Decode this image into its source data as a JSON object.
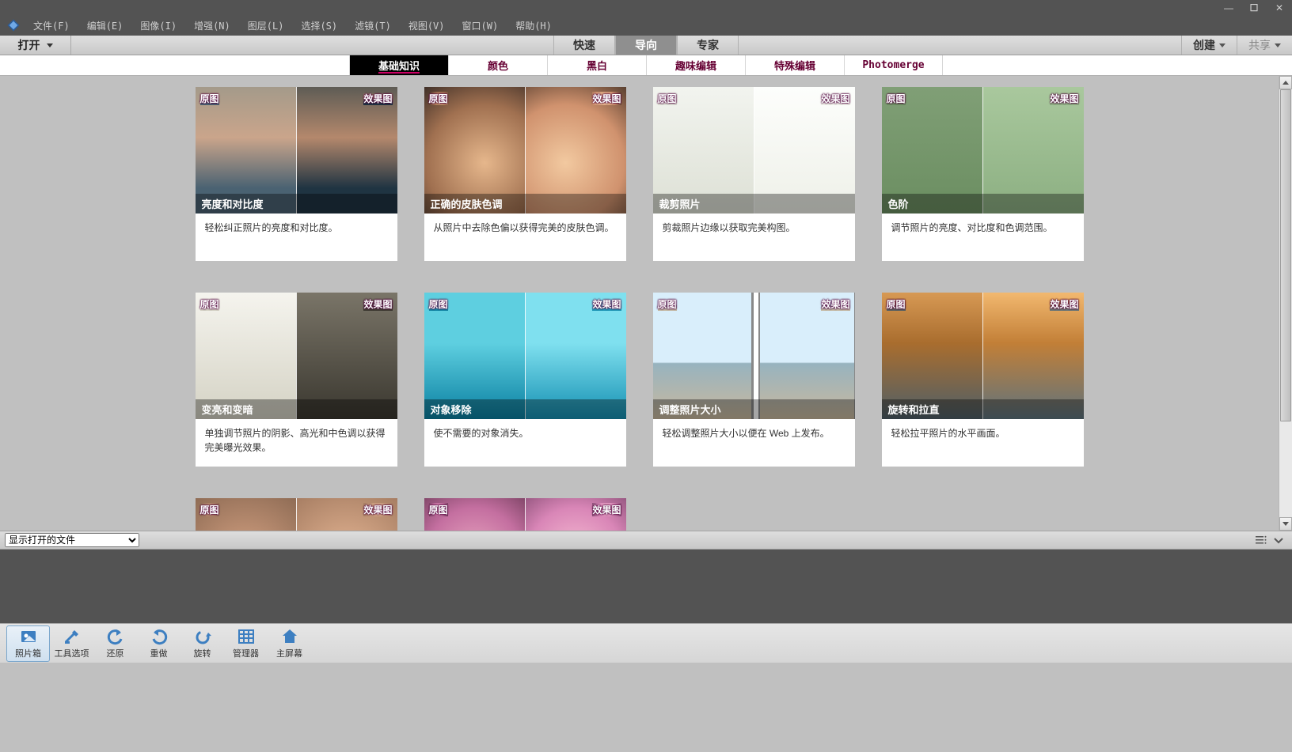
{
  "window_controls": {
    "min": "—",
    "max": "☐",
    "close": "✕"
  },
  "menu": [
    "文件(F)",
    "编辑(E)",
    "图像(I)",
    "增强(N)",
    "图层(L)",
    "选择(S)",
    "滤镜(T)",
    "视图(V)",
    "窗口(W)",
    "帮助(H)"
  ],
  "open_label": "打开",
  "modes": [
    {
      "label": "快速",
      "active": false
    },
    {
      "label": "导向",
      "active": true
    },
    {
      "label": "专家",
      "active": false
    }
  ],
  "mode_right": [
    {
      "label": "创建",
      "dim": false
    },
    {
      "label": "共享",
      "dim": true
    }
  ],
  "categories": [
    {
      "label": "基础知识",
      "active": true
    },
    {
      "label": "颜色",
      "active": false
    },
    {
      "label": "黑白",
      "active": false
    },
    {
      "label": "趣味编辑",
      "active": false
    },
    {
      "label": "特殊编辑",
      "active": false
    },
    {
      "label": "Photomerge",
      "active": false
    }
  ],
  "thumb_labels": {
    "before": "原图",
    "after": "效果图"
  },
  "cards": [
    {
      "title": "亮度和对比度",
      "desc": "轻松纠正照片的亮度和对比度。"
    },
    {
      "title": "正确的皮肤色调",
      "desc": "从照片中去除色偏以获得完美的皮肤色调。"
    },
    {
      "title": "裁剪照片",
      "desc": "剪裁照片边缘以获取完美构图。"
    },
    {
      "title": "色阶",
      "desc": "调节照片的亮度、对比度和色调范围。"
    },
    {
      "title": "变亮和变暗",
      "desc": "单独调节照片的阴影、高光和中色调以获得完美曝光效果。"
    },
    {
      "title": "对象移除",
      "desc": "使不需要的对象消失。"
    },
    {
      "title": "调整照片大小",
      "desc": "轻松调整照片大小以便在 Web 上发布。"
    },
    {
      "title": "旋转和拉直",
      "desc": "轻松拉平照片的水平画面。"
    },
    {
      "title": "",
      "desc": ""
    },
    {
      "title": "",
      "desc": ""
    }
  ],
  "photobin_select": "显示打开的文件",
  "action_items": [
    {
      "label": "照片箱",
      "icon": "photo",
      "active": true
    },
    {
      "label": "工具选项",
      "icon": "tools",
      "active": false
    },
    {
      "label": "还原",
      "icon": "undo",
      "active": false
    },
    {
      "label": "重做",
      "icon": "redo",
      "active": false
    },
    {
      "label": "旋转",
      "icon": "rotate",
      "active": false
    },
    {
      "label": "管理器",
      "icon": "grid",
      "active": false
    },
    {
      "label": "主屏幕",
      "icon": "home",
      "active": false
    }
  ]
}
